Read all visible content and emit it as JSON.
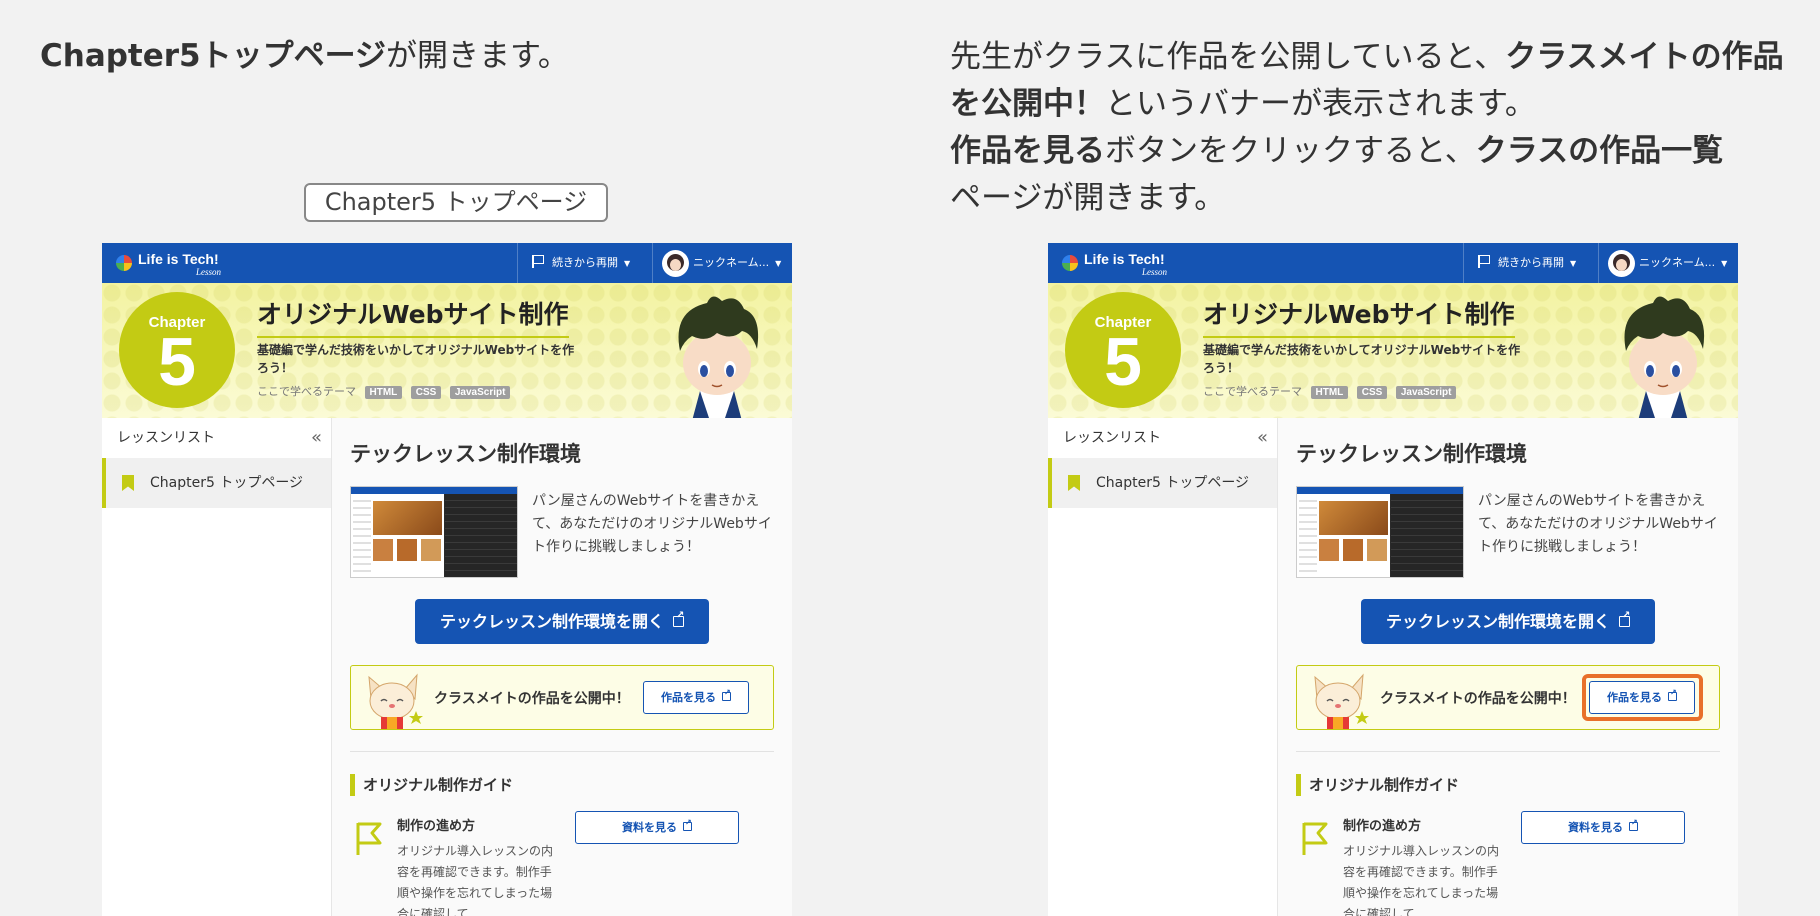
{
  "captions": {
    "left": {
      "bold": "Chapter5トップページ",
      "rest": "が開きます。"
    },
    "right": {
      "p1": "先生がクラスに作品を公開していると、",
      "b1": "クラスメイトの作品を公開中！",
      "p2": "というバナーが表示されます。",
      "b2": "作品を見る",
      "p3": "ボタンをクリックすると、",
      "b3": "クラスの作品一覧",
      "p4": "ページが開きます。"
    },
    "label_box": "Chapter5 トップページ"
  },
  "app": {
    "topbar": {
      "logo_text": "Life is Tech!",
      "logo_sub": "Lesson",
      "resume_label": "続きから再開",
      "user_label": "ニックネーム..."
    },
    "hero": {
      "chapter_label": "Chapter",
      "chapter_number": "5",
      "title": "オリジナルWebサイト制作",
      "description": "基礎編で学んだ技術をいかしてオリジナルWebサイトを作ろう！",
      "theme_label": "ここで学べるテーマ",
      "tags": [
        "HTML",
        "CSS",
        "JavaScript"
      ]
    },
    "sidebar": {
      "header": "レッスンリスト",
      "collapse_icon": "«",
      "items": [
        {
          "label": "Chapter5 トップページ"
        }
      ]
    },
    "main": {
      "lesson_title": "テックレッスン制作環境",
      "lesson_description": "パン屋さんのWebサイトを書きかえて、あなただけのオリジナルWebサイト作りに挑戦しましょう！",
      "open_button": "テックレッスン制作環境を開く",
      "banner_text": "クラスメイトの作品を公開中！",
      "works_button": "作品を見る",
      "guide_title": "オリジナル制作ガイド",
      "guide_item_title": "制作の進め方",
      "guide_item_desc": "オリジナル導入レッスンの内容を再確認できます。制作手順や操作を忘れてしまった場合に確認して",
      "doc_button": "資料を見る"
    }
  },
  "colors": {
    "brand_blue": "#1554b3",
    "accent_lime": "#c3cb14",
    "highlight_orange": "#e8702a"
  },
  "icons": [
    "flag-icon",
    "avatar",
    "bookmark-icon",
    "external-link-icon",
    "collapse-icon",
    "cat-mascot",
    "boy-character"
  ]
}
